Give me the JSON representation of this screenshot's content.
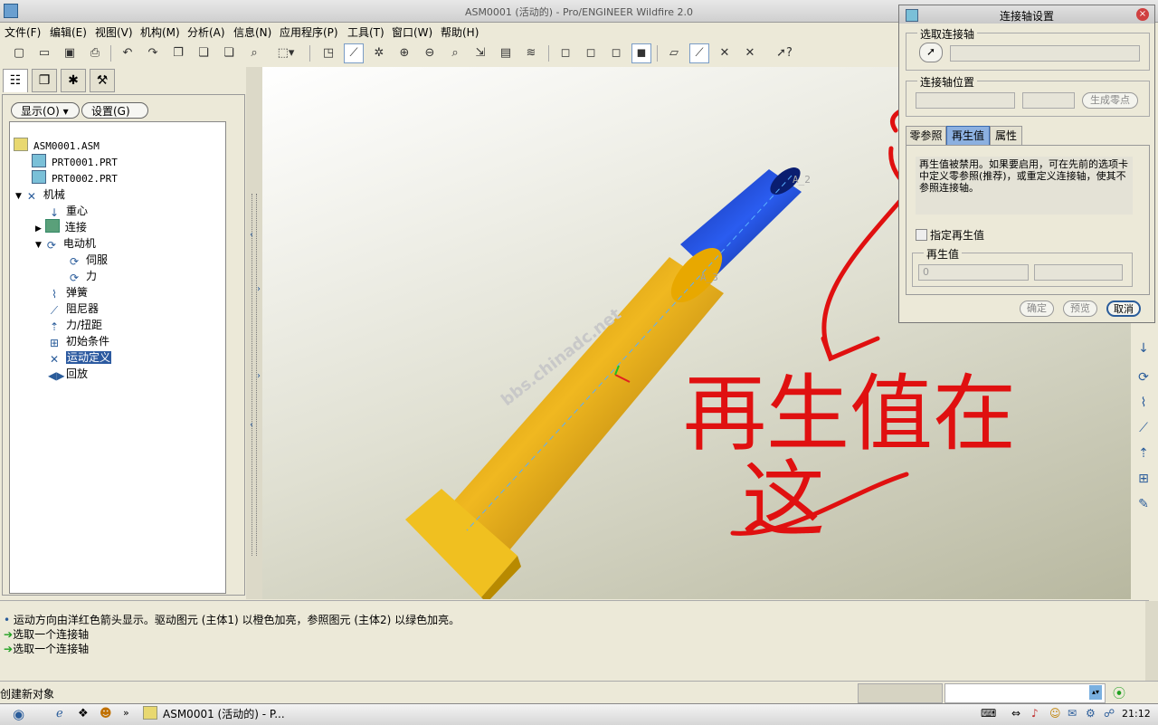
{
  "window": {
    "title": "ASM0001 (活动的) - Pro/ENGINEER Wildfire 2.0"
  },
  "menu": [
    "文件(F)",
    "编辑(E)",
    "视图(V)",
    "机构(M)",
    "分析(A)",
    "信息(N)",
    "应用程序(P)",
    "工具(T)",
    "窗口(W)",
    "帮助(H)"
  ],
  "left_panel": {
    "display_button": "显示(O) ▾",
    "settings_button": "设置(G) ▾",
    "tree": [
      {
        "label": "ASM0001.ASM"
      },
      {
        "label": "PRT0001.PRT"
      },
      {
        "label": "PRT0002.PRT"
      },
      {
        "label": "机械"
      },
      {
        "label": "重心"
      },
      {
        "label": "连接"
      },
      {
        "label": "电动机"
      },
      {
        "label": "伺服"
      },
      {
        "label": "力"
      },
      {
        "label": "弹簧"
      },
      {
        "label": "阻尼器"
      },
      {
        "label": "力/扭距"
      },
      {
        "label": "初始条件"
      },
      {
        "label": "运动定义"
      },
      {
        "label": "回放"
      }
    ]
  },
  "viewport": {
    "axis_label_top": "A_2",
    "axis_label_mid": "A_3",
    "watermark": "bbs.chinadc.net",
    "annotation_line1": "再生值在",
    "annotation_line2": "这"
  },
  "messages": [
    "运动方向由洋红色箭头显示。驱动图元 (主体1) 以橙色加亮，参照图元 (主体2) 以绿色加亮。",
    "选取一个连接轴",
    "选取一个连接轴"
  ],
  "status": {
    "left": "创建新对象"
  },
  "taskbar": {
    "window_button": "ASM0001 (活动的) - P...",
    "time": "21:12"
  },
  "dialog": {
    "title": "连接轴设置",
    "select_axis_group": "选取连接轴",
    "axis_position_group": "连接轴位置",
    "generate_zero_button": "生成零点",
    "tabs": [
      "零参照",
      "再生值",
      "属性"
    ],
    "info_text": "再生值被禁用。如果要启用，可在先前的选项卡中定义零参照(推荐)，或重定义连接轴，使其不参照连接轴。",
    "checkbox_label": "指定再生值",
    "regen_group": "再生值",
    "regen_value": "0",
    "ok_button": "确定",
    "preview_button": "预览",
    "cancel_button": "取消"
  },
  "colors": {
    "selection": "#2c5aa0",
    "annotation": "#e01010",
    "cylinder": "#e8a800",
    "shaft": "#1a3cc0"
  }
}
